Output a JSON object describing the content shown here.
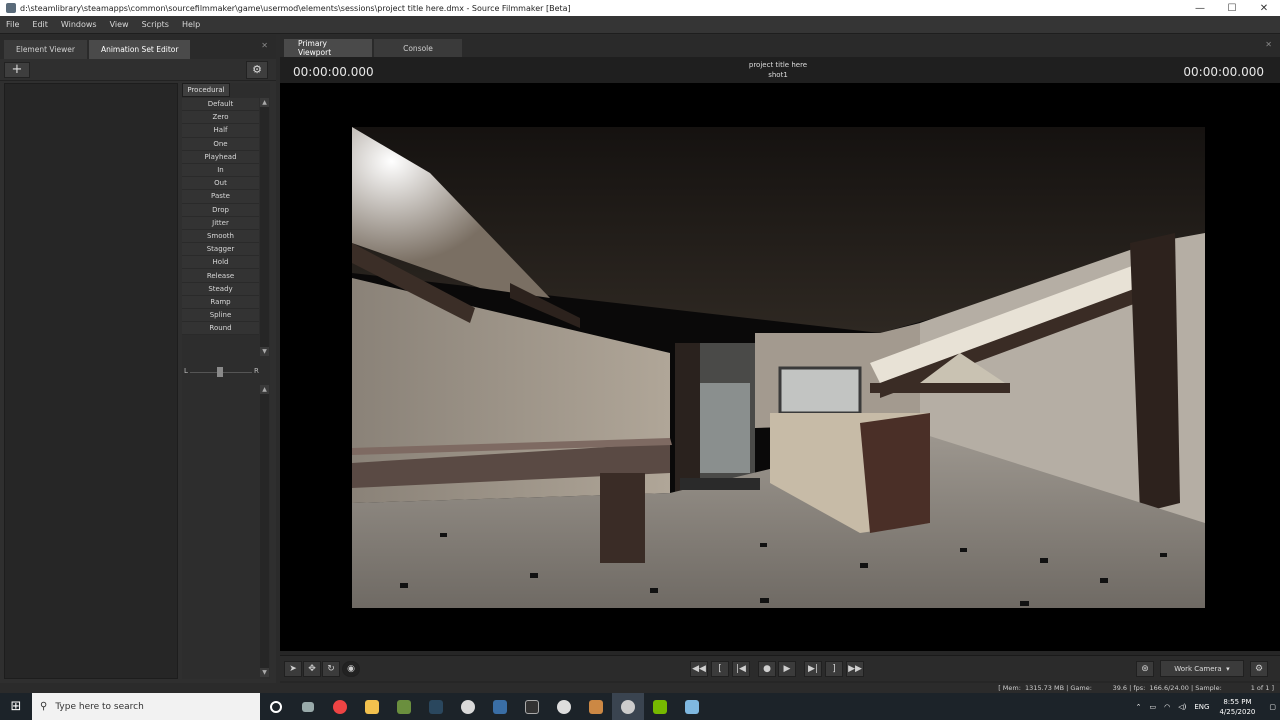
{
  "window": {
    "title": "d:\\steamlibrary\\steamapps\\common\\sourcefilmmaker\\game\\usermod\\elements\\sessions\\project title here.dmx - Source Filmmaker [Beta]",
    "minimize": "—",
    "maximize": "☐",
    "close": "✕"
  },
  "menu": [
    "File",
    "Edit",
    "Windows",
    "View",
    "Scripts",
    "Help"
  ],
  "left_panel": {
    "tabs": [
      "Element Viewer",
      "Animation Set Editor"
    ],
    "add_label": "+",
    "gear_label": "⚙",
    "procedural_header": "Procedural",
    "procedural_items": [
      "Default",
      "Zero",
      "Half",
      "One",
      "Playhead",
      "In",
      "Out",
      "Paste",
      "Drop",
      "Jitter",
      "Smooth",
      "Stagger",
      "Hold",
      "Release",
      "Steady",
      "Ramp",
      "Spline",
      "Round"
    ],
    "slider": {
      "left": "L",
      "right": "R",
      "value": 0.5
    }
  },
  "right_panel": {
    "tabs": [
      "Primary Viewport",
      "Console"
    ],
    "timecode_left": "00:00:00.000",
    "timecode_right": "00:00:00.000",
    "project_title": "project title here",
    "shot_name": "shot1",
    "work_camera": "Work Camera"
  },
  "status": {
    "text": "[ Mem:  1315.73 MB | Game:          39.6 | fps:  166.6/24.00 | Sample:              1 of 1 ]"
  },
  "taskbar": {
    "search_placeholder": "Type here to search",
    "lang": "ENG",
    "time": "8:55 PM",
    "date": "4/25/2020"
  },
  "colors": {
    "panel_bg": "#2f2f2f",
    "viewport_bg": "#000000",
    "taskbar_bg": "#1c2329"
  }
}
